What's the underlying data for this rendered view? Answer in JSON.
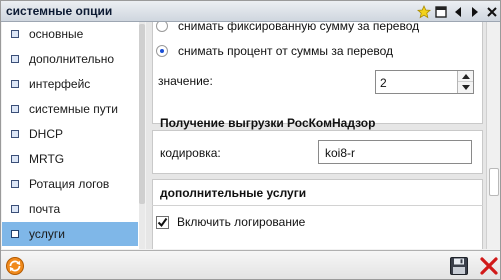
{
  "window": {
    "title": "системные опции",
    "title_icons": [
      "star-icon",
      "maximize-icon",
      "arrow-left-icon",
      "arrow-right-icon",
      "close-icon"
    ]
  },
  "sidebar": {
    "items": [
      {
        "label": "основные",
        "selected": false
      },
      {
        "label": "дополнительно",
        "selected": false
      },
      {
        "label": "интерфейс",
        "selected": false
      },
      {
        "label": "системные пути",
        "selected": false
      },
      {
        "label": "DHCP",
        "selected": false
      },
      {
        "label": "MRTG",
        "selected": false
      },
      {
        "label": "Ротация логов",
        "selected": false
      },
      {
        "label": "почта",
        "selected": false
      },
      {
        "label": "услуги",
        "selected": true
      }
    ]
  },
  "content": {
    "radio_fixed_label": "снимать фиксированную сумму за перевод",
    "radio_percent_label": "снимать процент от суммы за перевод",
    "value_label": "значение:",
    "value": "2",
    "section_roskomnadzor": "Получение выгрузки РосКомНадзор",
    "encoding_label": "кодировка:",
    "encoding_value": "koi8-r",
    "section_additional": "дополнительные услуги",
    "logging_label": "Включить логирование",
    "logging_checked": true
  },
  "statusbar": {
    "icons": [
      "refresh-icon",
      "save-icon",
      "close-icon"
    ]
  },
  "colors": {
    "selected_item_bg": "#7fb7e8",
    "close_red": "#d11a1a"
  }
}
